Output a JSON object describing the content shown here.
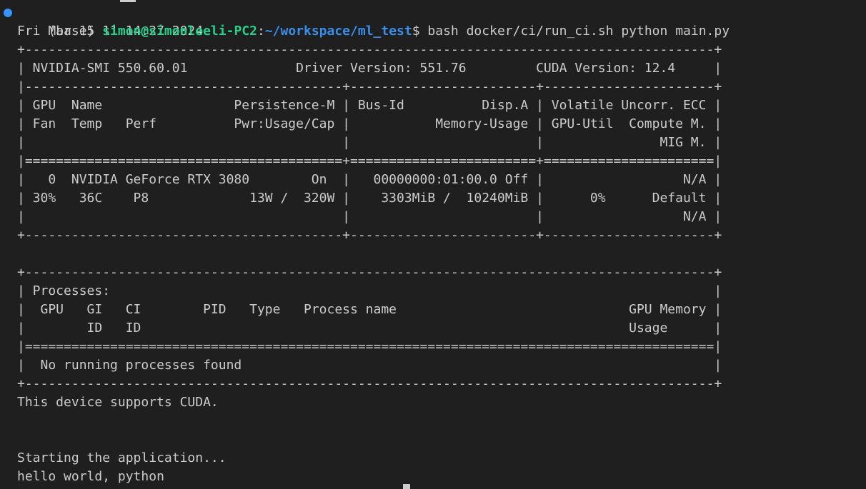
{
  "colors": {
    "background": "#1f1f1f",
    "foreground": "#cccccc",
    "user_host": "#23d18b",
    "path": "#3b8eea",
    "status_dot": "#3794ff"
  },
  "prompt": {
    "env": "(base) ",
    "user_host": "simon@simonleeli-PC2",
    "separator": ":",
    "path": "~/workspace/ml_test",
    "symbol": "$ ",
    "command": "bash docker/ci/run_ci.sh python main.py"
  },
  "output": [
    "Fri Mar 15 11:14:27 2024",
    "+-----------------------------------------------------------------------------------------+",
    "| NVIDIA-SMI 550.60.01              Driver Version: 551.76         CUDA Version: 12.4     |",
    "|-----------------------------------------+------------------------+----------------------+",
    "| GPU  Name                 Persistence-M | Bus-Id          Disp.A | Volatile Uncorr. ECC |",
    "| Fan  Temp   Perf          Pwr:Usage/Cap |           Memory-Usage | GPU-Util  Compute M. |",
    "|                                         |                        |               MIG M. |",
    "|=========================================+========================+======================|",
    "|   0  NVIDIA GeForce RTX 3080        On  |   00000000:01:00.0 Off |                  N/A |",
    "| 30%   36C    P8             13W /  320W |    3303MiB /  10240MiB |      0%      Default |",
    "|                                         |                        |                  N/A |",
    "+-----------------------------------------+------------------------+----------------------+",
    "",
    "+-----------------------------------------------------------------------------------------+",
    "| Processes:                                                                              |",
    "|  GPU   GI   CI        PID   Type   Process name                              GPU Memory |",
    "|        ID   ID                                                               Usage      |",
    "|=========================================================================================|",
    "|  No running processes found                                                             |",
    "+-----------------------------------------------------------------------------------------+",
    "This device supports CUDA.",
    "",
    "",
    "Starting the application...",
    "hello world, python"
  ]
}
